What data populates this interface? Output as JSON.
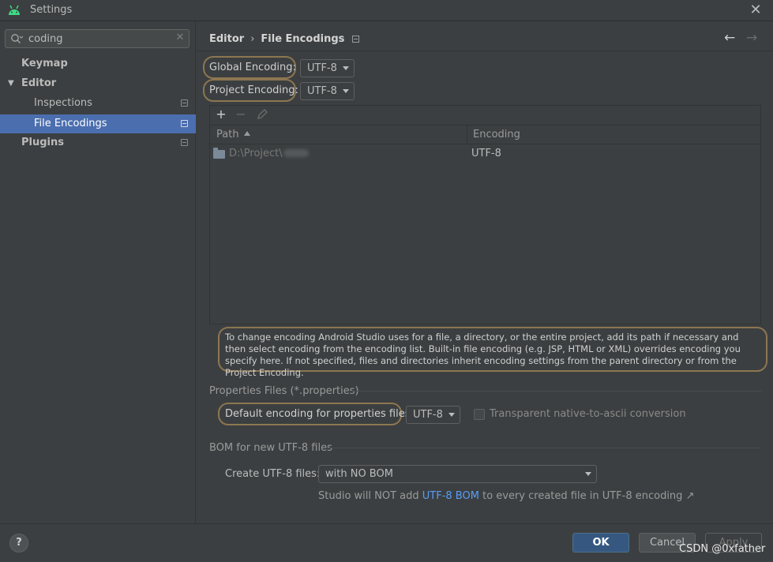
{
  "window": {
    "title": "Settings"
  },
  "sidebar": {
    "search": {
      "value": "coding",
      "clear_icon": "close-icon"
    },
    "items": [
      {
        "label": "Keymap",
        "bold": true,
        "indent": 0
      },
      {
        "label": "Editor",
        "bold": true,
        "expanded": true
      },
      {
        "label": "Inspections",
        "bold": false
      },
      {
        "label": "File Encodings",
        "bold": false,
        "selected": true
      },
      {
        "label": "Plugins",
        "bold": true
      }
    ]
  },
  "header": {
    "breadcrumb": [
      "Editor",
      "File Encodings"
    ],
    "separator": "›"
  },
  "encodings": {
    "global_label": "Global Encoding:",
    "global_value": "UTF-8",
    "project_label": "Project Encoding:",
    "project_value": "UTF-8"
  },
  "toolbar": {
    "add": "+",
    "remove": "−"
  },
  "table": {
    "columns": [
      "Path",
      "Encoding"
    ],
    "rows": [
      {
        "path": "D:\\Project\\",
        "encoding": "UTF-8"
      }
    ]
  },
  "info_text": "To change encoding Android Studio uses for a file, a directory, or the entire project, add its path if necessary and then select encoding from the encoding list. Built-in file encoding (e.g. JSP, HTML or XML) overrides encoding you specify here. If not specified, files and directories inherit encoding settings from the parent directory or from the Project Encoding.",
  "properties": {
    "section_title": "Properties Files (*.properties)",
    "default_label": "Default encoding for properties files:",
    "default_value": "UTF-8",
    "checkbox_label": "Transparent native-to-ascii conversion",
    "checkbox_checked": false
  },
  "bom": {
    "section_title": "BOM for new UTF-8 files",
    "create_label": "Create UTF-8 files:",
    "create_value": "with NO BOM",
    "note_prefix": "Studio will NOT add",
    "note_link": "UTF-8 BOM",
    "note_suffix": "to every created file in UTF-8 encoding",
    "note_arrow": "↗"
  },
  "footer": {
    "help": "?",
    "ok": "OK",
    "cancel": "Cancel",
    "apply": "Apply"
  },
  "watermark": "CSDN @0xfather",
  "colors": {
    "background": "#3c3f41",
    "selection": "#4b6eaf",
    "ok_button": "#365880",
    "highlight_outline": "#8c7650",
    "link": "#589df6",
    "android_green": "#3ddc84"
  }
}
